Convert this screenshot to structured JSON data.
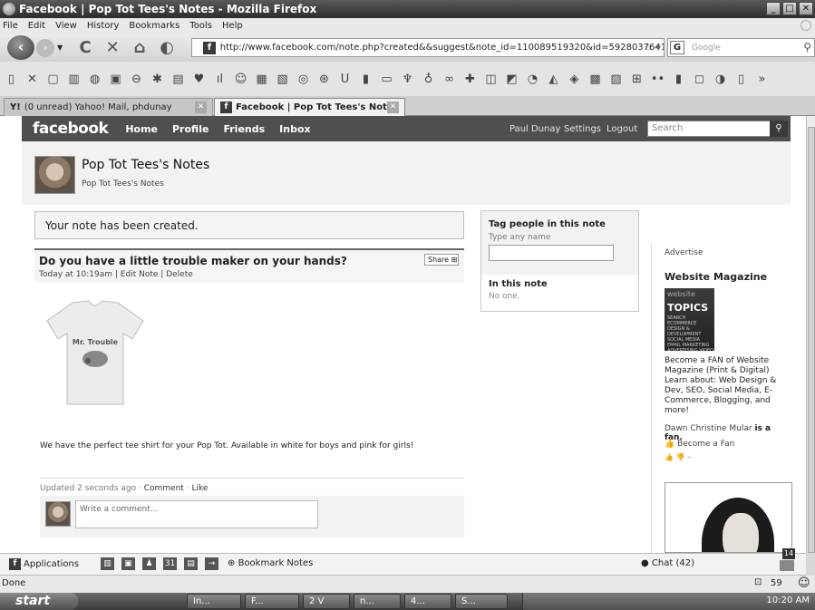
{
  "window": {
    "title": "Facebook | Pop Tot Tees's Notes - Mozilla Firefox"
  },
  "menu": [
    "File",
    "Edit",
    "View",
    "History",
    "Bookmarks",
    "Tools",
    "Help"
  ],
  "navbar": {
    "url": "http://www.facebook.com/note.php?created&&suggest&note_id=110089519320&id=59280376416",
    "search_placeholder": "Google"
  },
  "tabs": [
    {
      "label": "(0 unread) Yahoo! Mail, phdunay"
    },
    {
      "label": "Facebook | Pop Tot Tees's Notes"
    }
  ],
  "fb": {
    "logo": "facebook",
    "nav": [
      "Home",
      "Profile",
      "Friends",
      "Inbox"
    ],
    "user": "Paul Dunay",
    "settings": "Settings",
    "logout": "Logout",
    "search_placeholder": "Search"
  },
  "page": {
    "title": "Pop Tot Tees's Notes",
    "subtitle": "Pop Tot Tees's Notes"
  },
  "notice": "Your note has been created.",
  "note": {
    "title": "Do you have a little trouble maker on your hands?",
    "share": "Share",
    "time": "Today at 10:19am",
    "edit": "Edit Note",
    "delete": "Delete",
    "shirt_text": "Mr. Trouble",
    "body": "We have the perfect tee shirt for your Pop Tot. Available in white for boys and pink for girls!",
    "updated": "Updated 2 seconds ago",
    "comment_link": "Comment",
    "like_link": "Like",
    "comment_placeholder": "Write a comment..."
  },
  "tag": {
    "heading": "Tag people in this note",
    "hint": "Type any name",
    "in_note_heading": "In this note",
    "in_note_value": "No one."
  },
  "ad": {
    "label": "Advertise",
    "title": "Website Magazine",
    "img_line1": "website",
    "img_line2": "TOPICS",
    "img_line3": "SEARCH ECOMMERCE DESIGN & DEVELOPMENT SOCIAL MEDIA EMAIL MARKETING ADVERTISING VIDEO",
    "text": "Become a FAN of Website Magazine (Print & Digital) Learn about: Web Design & Dev, SEO, Social Media, E-Commerce, Blogging, and more!",
    "fan_name": "Dawn Christine Mular",
    "fan_suffix": "is a fan.",
    "become_fan": "Become a Fan"
  },
  "bottom": {
    "applications": "Applications",
    "bookmark": "Bookmark Notes",
    "chat": "Chat (42)",
    "notif_count": "14"
  },
  "status": {
    "text": "Done",
    "count": "59"
  },
  "taskbar": {
    "start": "start",
    "buttons": [
      "In...",
      "F...",
      "2 V",
      "n...",
      "4...",
      "S..."
    ],
    "clock": "10:20 AM"
  }
}
